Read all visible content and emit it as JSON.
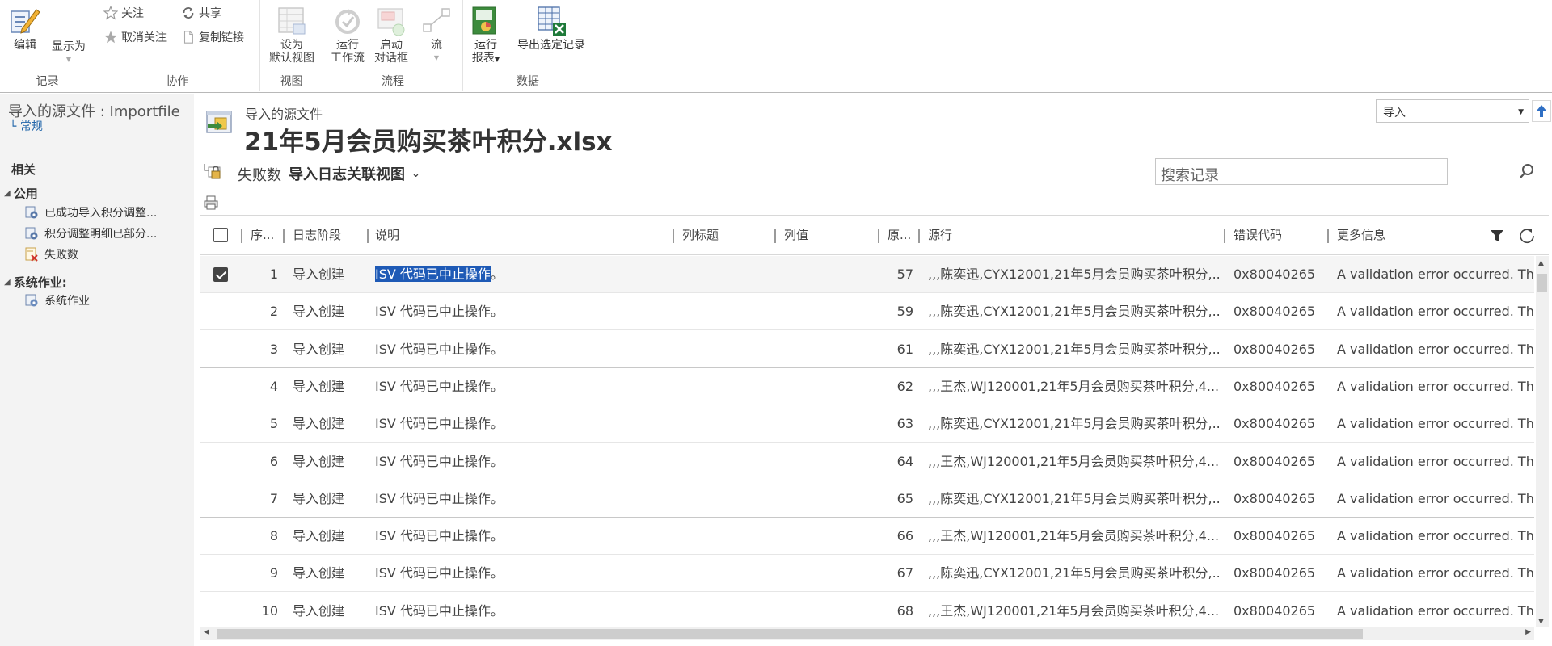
{
  "ribbon": {
    "groups": {
      "record": "记录",
      "collab": "协作",
      "view": "视图",
      "process": "流程",
      "data": "数据"
    },
    "edit": "编辑",
    "show_as": "显示为",
    "follow": "关注",
    "unfollow": "取消关注",
    "share": "共享",
    "copy_link": "复制链接",
    "set_default_view": [
      "设为",
      "默认视图"
    ],
    "run_workflow": [
      "运行",
      "工作流"
    ],
    "start_dialog": [
      "启动",
      "对话框"
    ],
    "flow": "流",
    "run_report": [
      "运行",
      "报表"
    ],
    "export_selected": "导出选定记录"
  },
  "leftnav": {
    "entity_title": "导入的源文件 : Importfile",
    "form_name": "└ 常规",
    "related_heading": "相关",
    "public_section": "公用",
    "public_items": [
      "已成功导入积分调整...",
      "积分调整明细已部分...",
      "失败数"
    ],
    "system_section": "系统作业:",
    "system_items": [
      "系统作业"
    ]
  },
  "header": {
    "entity_label": "导入的源文件",
    "title": "21年5月会员购买茶叶积分.xlsx",
    "nav_select_value": "导入"
  },
  "view": {
    "fail_label": "失败数",
    "name": "导入日志关联视图",
    "search_placeholder": "搜索记录"
  },
  "grid": {
    "columns": [
      "序...",
      "日志阶段",
      "说明",
      "列标题",
      "列值",
      "原...",
      "源行",
      "错误代码",
      "更多信息"
    ],
    "rows": [
      {
        "seq": "1",
        "stage": "导入创建",
        "desc_hl": "ISV 代码已中止操作",
        "desc_rest": "。",
        "orig": "57",
        "src": ",,,陈奕迅,CYX12001,21年5月会员购买茶叶积分,...",
        "code": "0x80040265",
        "more": "A validation error occurred. Th"
      },
      {
        "seq": "2",
        "stage": "导入创建",
        "desc_hl": "",
        "desc_rest": "ISV 代码已中止操作。",
        "orig": "59",
        "src": ",,,陈奕迅,CYX12001,21年5月会员购买茶叶积分,...",
        "code": "0x80040265",
        "more": "A validation error occurred. Th"
      },
      {
        "seq": "3",
        "stage": "导入创建",
        "desc_hl": "",
        "desc_rest": "ISV 代码已中止操作。",
        "orig": "61",
        "src": ",,,陈奕迅,CYX12001,21年5月会员购买茶叶积分,...",
        "code": "0x80040265",
        "more": "A validation error occurred. Th"
      },
      {
        "seq": "4",
        "stage": "导入创建",
        "desc_hl": "",
        "desc_rest": "ISV 代码已中止操作。",
        "orig": "62",
        "src": ",,,王杰,WJ120001,21年5月会员购买茶叶积分,4...",
        "code": "0x80040265",
        "more": "A validation error occurred. Th"
      },
      {
        "seq": "5",
        "stage": "导入创建",
        "desc_hl": "",
        "desc_rest": "ISV 代码已中止操作。",
        "orig": "63",
        "src": ",,,陈奕迅,CYX12001,21年5月会员购买茶叶积分,...",
        "code": "0x80040265",
        "more": "A validation error occurred. Th"
      },
      {
        "seq": "6",
        "stage": "导入创建",
        "desc_hl": "",
        "desc_rest": "ISV 代码已中止操作。",
        "orig": "64",
        "src": ",,,王杰,WJ120001,21年5月会员购买茶叶积分,4...",
        "code": "0x80040265",
        "more": "A validation error occurred. Th"
      },
      {
        "seq": "7",
        "stage": "导入创建",
        "desc_hl": "",
        "desc_rest": "ISV 代码已中止操作。",
        "orig": "65",
        "src": ",,,陈奕迅,CYX12001,21年5月会员购买茶叶积分,...",
        "code": "0x80040265",
        "more": "A validation error occurred. Th"
      },
      {
        "seq": "8",
        "stage": "导入创建",
        "desc_hl": "",
        "desc_rest": "ISV 代码已中止操作。",
        "orig": "66",
        "src": ",,,王杰,WJ120001,21年5月会员购买茶叶积分,4...",
        "code": "0x80040265",
        "more": "A validation error occurred. Th"
      },
      {
        "seq": "9",
        "stage": "导入创建",
        "desc_hl": "",
        "desc_rest": "ISV 代码已中止操作。",
        "orig": "67",
        "src": ",,,陈奕迅,CYX12001,21年5月会员购买茶叶积分,...",
        "code": "0x80040265",
        "more": "A validation error occurred. Th"
      },
      {
        "seq": "10",
        "stage": "导入创建",
        "desc_hl": "",
        "desc_rest": "ISV 代码已中止操作。",
        "orig": "68",
        "src": ",,,王杰,WJ120001,21年5月会员购买茶叶积分,4...",
        "code": "0x80040265",
        "more": "A validation error occurred. Th"
      }
    ]
  },
  "colors": {
    "selection_highlight": "#1e5ab6",
    "nav_background": "#f3f3f3",
    "link_blue": "#2266aa"
  }
}
